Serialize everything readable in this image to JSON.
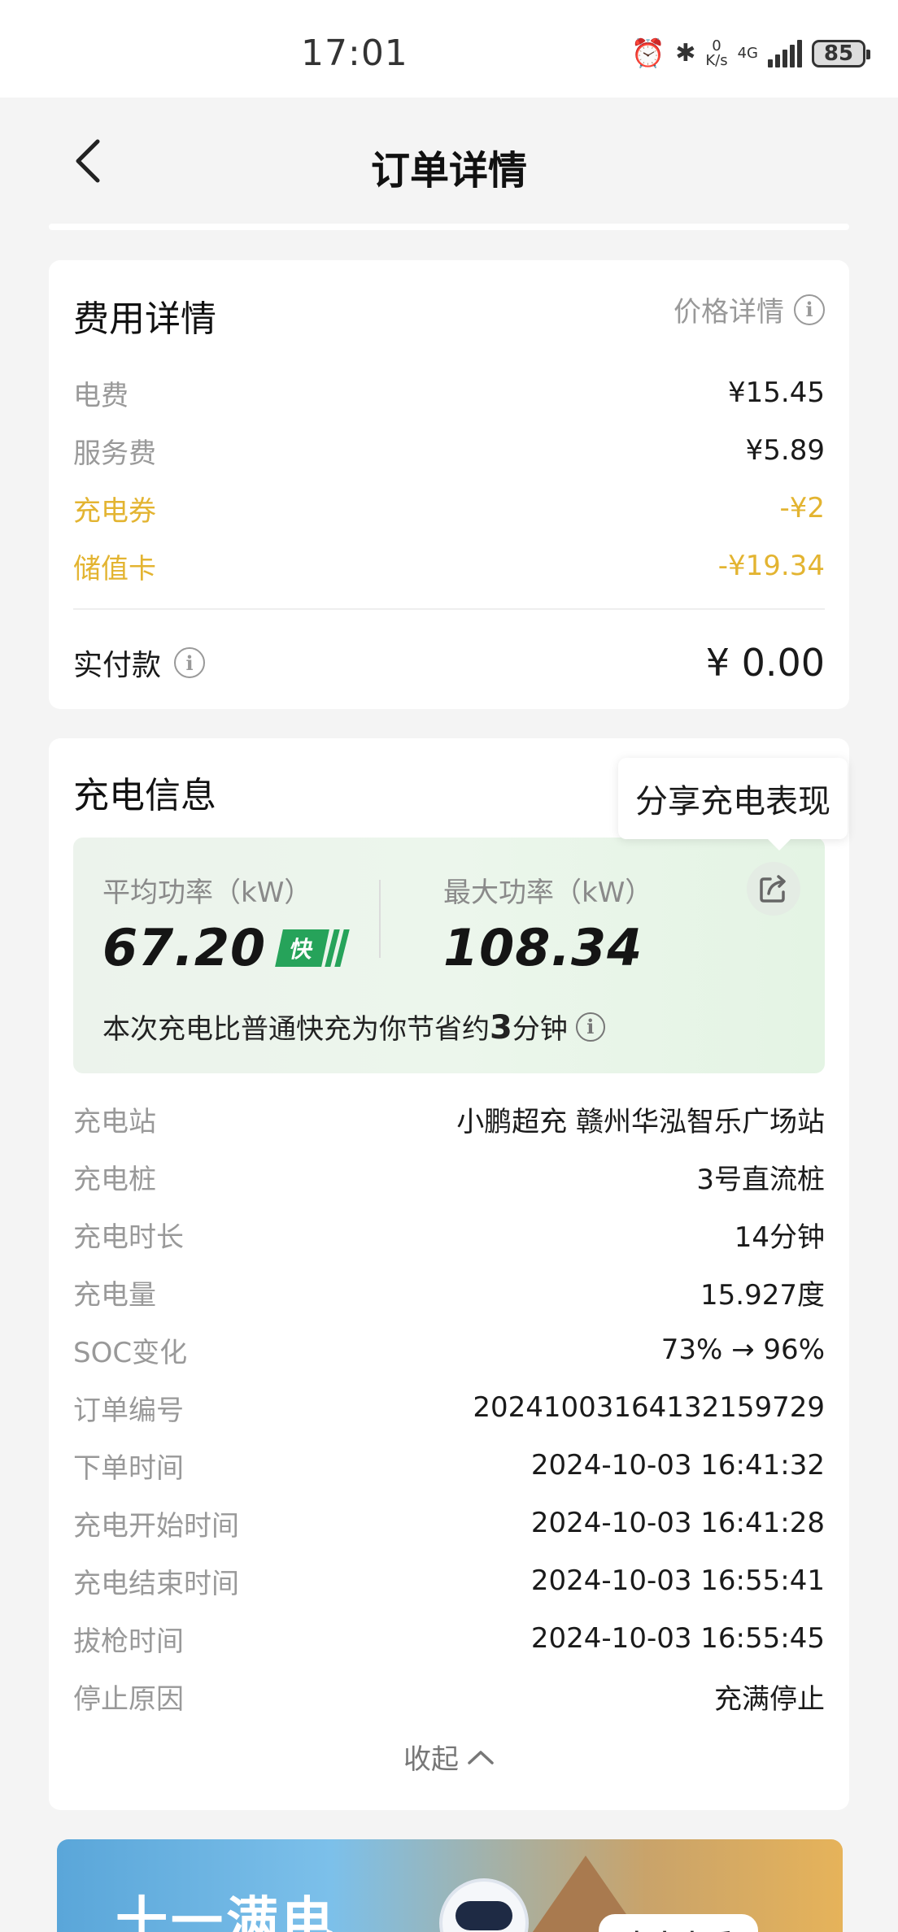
{
  "status_bar": {
    "time": "17:01",
    "net_speed_value": "0",
    "net_speed_unit": "K/s",
    "network": "4G",
    "battery": "85"
  },
  "nav": {
    "title": "订单详情"
  },
  "fee": {
    "title": "费用详情",
    "price_detail": "价格详情",
    "rows": [
      {
        "label": "电费",
        "value": "¥15.45"
      },
      {
        "label": "服务费",
        "value": "¥5.89"
      },
      {
        "label": "充电券",
        "value": "-¥2"
      },
      {
        "label": "储值卡",
        "value": "-¥19.34"
      }
    ],
    "paid_label": "实付款",
    "paid_value": "¥ 0.00"
  },
  "charge": {
    "title": "充电信息",
    "tooltip": "分享充电表现",
    "avg_power_label": "平均功率（kW）",
    "avg_power_value": "67.20",
    "fast_badge": "快",
    "max_power_label": "最大功率（kW）",
    "max_power_value": "108.34",
    "saving_prefix": "本次充电比普通快充为你节省约",
    "saving_minutes": "3",
    "saving_suffix": "分钟",
    "rows": [
      {
        "label": "充电站",
        "value": "小鹏超充 赣州华泓智乐广场站"
      },
      {
        "label": "充电桩",
        "value": "3号直流桩"
      },
      {
        "label": "充电时长",
        "value": "14分钟"
      },
      {
        "label": "充电量",
        "value": "15.927度"
      },
      {
        "label": "SOC变化",
        "value": "73% → 96%"
      },
      {
        "label": "订单编号",
        "value": "20241003164132159729"
      },
      {
        "label": "下单时间",
        "value": "2024-10-03 16:41:32"
      },
      {
        "label": "充电开始时间",
        "value": "2024-10-03 16:41:28"
      },
      {
        "label": "充电结束时间",
        "value": "2024-10-03 16:55:41"
      },
      {
        "label": "拔枪时间",
        "value": "2024-10-03 16:55:45"
      },
      {
        "label": "停止原因",
        "value": "充满停止"
      }
    ],
    "collapse": "收起"
  },
  "banner": {
    "text": "十一满电",
    "button": "点击查看"
  },
  "colors": {
    "discount": "#e3b431",
    "fast_badge": "#26a35a"
  }
}
